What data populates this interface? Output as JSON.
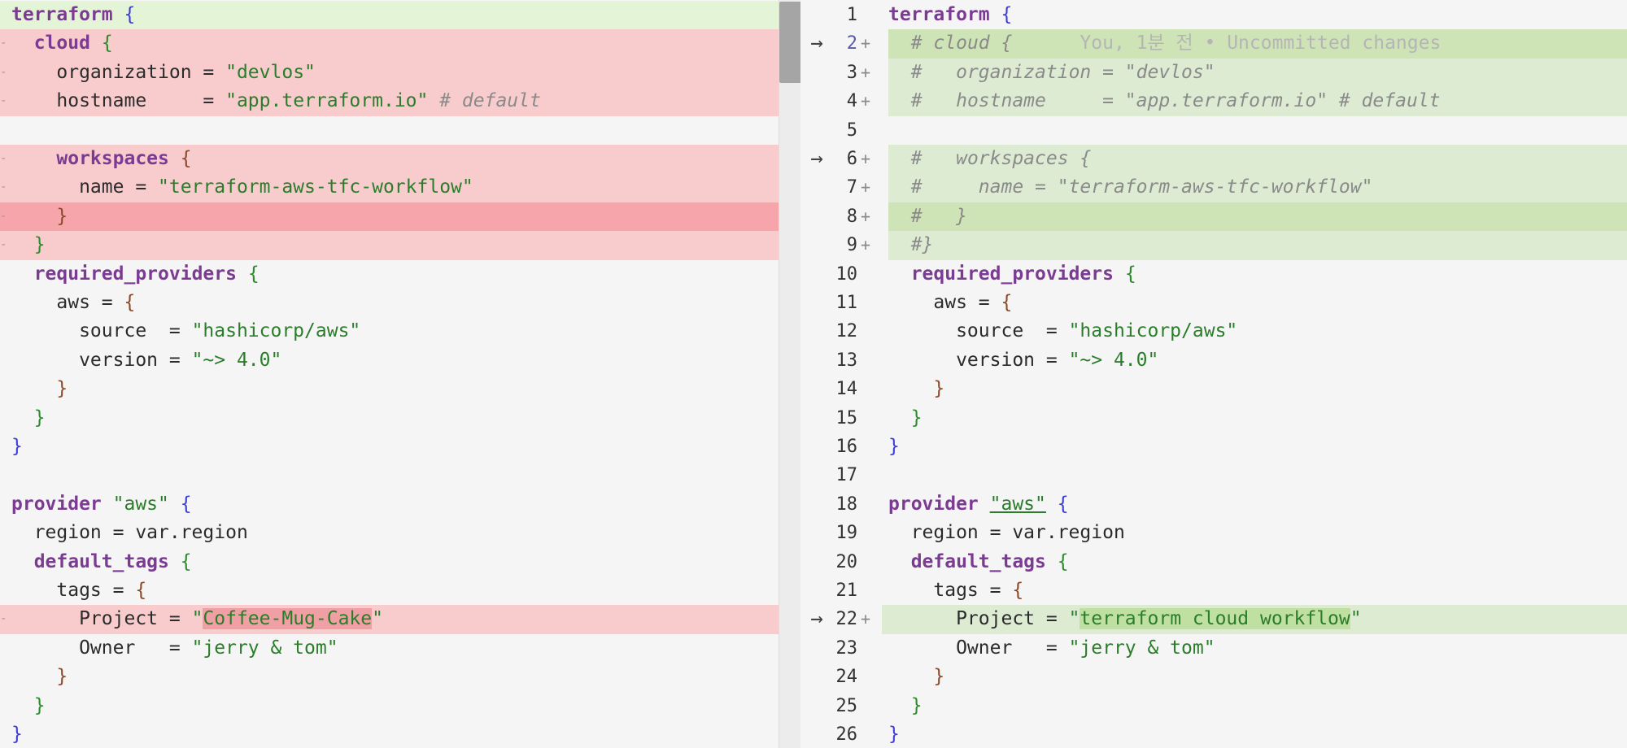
{
  "left": {
    "lines": [
      {
        "cls": "ctx-green",
        "tokens": [
          {
            "t": "terraform",
            "c": "kw"
          },
          {
            "t": " "
          },
          {
            "t": "{",
            "c": "brace"
          }
        ]
      },
      {
        "cls": "rm",
        "mark": "-",
        "tokens": [
          {
            "t": "  "
          },
          {
            "t": "cloud",
            "c": "kw"
          },
          {
            "t": " "
          },
          {
            "t": "{",
            "c": "brace2"
          }
        ]
      },
      {
        "cls": "rm",
        "mark": "-",
        "tokens": [
          {
            "t": "    organization = "
          },
          {
            "t": "\"devlos\"",
            "c": "str"
          }
        ]
      },
      {
        "cls": "rm",
        "mark": "-",
        "tokens": [
          {
            "t": "    hostname     = "
          },
          {
            "t": "\"app.terraform.io\"",
            "c": "str"
          },
          {
            "t": " "
          },
          {
            "t": "# default",
            "c": "cm"
          }
        ]
      },
      {
        "cls": "",
        "tokens": [
          {
            "t": ""
          }
        ]
      },
      {
        "cls": "rm",
        "mark": "-",
        "tokens": [
          {
            "t": "    "
          },
          {
            "t": "workspaces",
            "c": "kw"
          },
          {
            "t": " "
          },
          {
            "t": "{",
            "c": "brace3"
          }
        ]
      },
      {
        "cls": "rm",
        "mark": "-",
        "tokens": [
          {
            "t": "      name = "
          },
          {
            "t": "\"terraform-aws-tfc-workflow\"",
            "c": "str"
          }
        ]
      },
      {
        "cls": "rm-strong",
        "mark": "-",
        "tokens": [
          {
            "t": "    "
          },
          {
            "t": "}",
            "c": "brace3"
          }
        ]
      },
      {
        "cls": "rm",
        "mark": "-",
        "tokens": [
          {
            "t": "  "
          },
          {
            "t": "}",
            "c": "brace2"
          }
        ]
      },
      {
        "cls": "",
        "tokens": [
          {
            "t": "  "
          },
          {
            "t": "required_providers",
            "c": "kw"
          },
          {
            "t": " "
          },
          {
            "t": "{",
            "c": "brace2"
          }
        ]
      },
      {
        "cls": "",
        "tokens": [
          {
            "t": "    aws = "
          },
          {
            "t": "{",
            "c": "brace3"
          }
        ]
      },
      {
        "cls": "",
        "tokens": [
          {
            "t": "      source  = "
          },
          {
            "t": "\"hashicorp/aws\"",
            "c": "str"
          }
        ]
      },
      {
        "cls": "",
        "tokens": [
          {
            "t": "      version = "
          },
          {
            "t": "\"~> 4.0\"",
            "c": "str"
          }
        ]
      },
      {
        "cls": "",
        "tokens": [
          {
            "t": "    "
          },
          {
            "t": "}",
            "c": "brace3"
          }
        ]
      },
      {
        "cls": "",
        "tokens": [
          {
            "t": "  "
          },
          {
            "t": "}",
            "c": "brace2"
          }
        ]
      },
      {
        "cls": "",
        "tokens": [
          {
            "t": "}",
            "c": "brace"
          }
        ]
      },
      {
        "cls": "",
        "tokens": [
          {
            "t": ""
          }
        ]
      },
      {
        "cls": "",
        "tokens": [
          {
            "t": "provider",
            "c": "kw"
          },
          {
            "t": " "
          },
          {
            "t": "\"aws\"",
            "c": "str"
          },
          {
            "t": " "
          },
          {
            "t": "{",
            "c": "brace"
          }
        ]
      },
      {
        "cls": "",
        "tokens": [
          {
            "t": "  region = var.region"
          }
        ]
      },
      {
        "cls": "",
        "tokens": [
          {
            "t": "  "
          },
          {
            "t": "default_tags",
            "c": "kw"
          },
          {
            "t": " "
          },
          {
            "t": "{",
            "c": "brace2"
          }
        ]
      },
      {
        "cls": "",
        "tokens": [
          {
            "t": "    tags = "
          },
          {
            "t": "{",
            "c": "brace3"
          }
        ]
      },
      {
        "cls": "rm",
        "mark": "-",
        "tokens": [
          {
            "t": "      Project = "
          },
          {
            "t": "\"",
            "c": "str"
          },
          {
            "t": "Coffee-Mug-Cake",
            "c": "str hl-rm"
          },
          {
            "t": "\"",
            "c": "str"
          }
        ]
      },
      {
        "cls": "",
        "tokens": [
          {
            "t": "      Owner   = "
          },
          {
            "t": "\"jerry & tom\"",
            "c": "str"
          }
        ]
      },
      {
        "cls": "",
        "tokens": [
          {
            "t": "    "
          },
          {
            "t": "}",
            "c": "brace3"
          }
        ]
      },
      {
        "cls": "",
        "tokens": [
          {
            "t": "  "
          },
          {
            "t": "}",
            "c": "brace2"
          }
        ]
      },
      {
        "cls": "",
        "tokens": [
          {
            "t": "}",
            "c": "brace"
          }
        ]
      }
    ]
  },
  "right": {
    "lines": [
      {
        "num": "1",
        "cls": "",
        "tokens": [
          {
            "t": "terraform",
            "c": "kw"
          },
          {
            "t": " "
          },
          {
            "t": "{",
            "c": "brace"
          }
        ]
      },
      {
        "num": "2",
        "changed": true,
        "plus": true,
        "arrow": true,
        "cls": "add-strong",
        "tokens": [
          {
            "t": "  "
          },
          {
            "t": "# cloud {",
            "c": "cm"
          },
          {
            "t": "      You, 1분 전 • Uncommitted changes",
            "c": "blame"
          }
        ]
      },
      {
        "num": "3",
        "plus": true,
        "cls": "add",
        "tokens": [
          {
            "t": "  "
          },
          {
            "t": "#   organization = \"devlos\"",
            "c": "cm"
          }
        ]
      },
      {
        "num": "4",
        "plus": true,
        "cls": "add",
        "tokens": [
          {
            "t": "  "
          },
          {
            "t": "#   hostname     = \"app.terraform.io\" # default",
            "c": "cm"
          }
        ]
      },
      {
        "num": "5",
        "cls": "",
        "tokens": [
          {
            "t": ""
          }
        ]
      },
      {
        "num": "6",
        "plus": true,
        "arrow": true,
        "cls": "add",
        "tokens": [
          {
            "t": "  "
          },
          {
            "t": "#   workspaces {",
            "c": "cm"
          }
        ]
      },
      {
        "num": "7",
        "plus": true,
        "cls": "add",
        "tokens": [
          {
            "t": "  "
          },
          {
            "t": "#     name = \"terraform-aws-tfc-workflow\"",
            "c": "cm"
          }
        ]
      },
      {
        "num": "8",
        "plus": true,
        "cls": "add-strong",
        "tokens": [
          {
            "t": "  "
          },
          {
            "t": "#   }",
            "c": "cm"
          }
        ]
      },
      {
        "num": "9",
        "plus": true,
        "cls": "add",
        "tokens": [
          {
            "t": "  "
          },
          {
            "t": "#}",
            "c": "cm"
          }
        ]
      },
      {
        "num": "10",
        "cls": "",
        "tokens": [
          {
            "t": "  "
          },
          {
            "t": "required_providers",
            "c": "kw"
          },
          {
            "t": " "
          },
          {
            "t": "{",
            "c": "brace2"
          }
        ]
      },
      {
        "num": "11",
        "cls": "",
        "tokens": [
          {
            "t": "    aws = "
          },
          {
            "t": "{",
            "c": "brace3"
          }
        ]
      },
      {
        "num": "12",
        "cls": "",
        "tokens": [
          {
            "t": "      source  = "
          },
          {
            "t": "\"hashicorp/aws\"",
            "c": "str"
          }
        ]
      },
      {
        "num": "13",
        "cls": "",
        "tokens": [
          {
            "t": "      version = "
          },
          {
            "t": "\"~> 4.0\"",
            "c": "str"
          }
        ]
      },
      {
        "num": "14",
        "cls": "",
        "tokens": [
          {
            "t": "    "
          },
          {
            "t": "}",
            "c": "brace3"
          }
        ]
      },
      {
        "num": "15",
        "cls": "",
        "tokens": [
          {
            "t": "  "
          },
          {
            "t": "}",
            "c": "brace2"
          }
        ]
      },
      {
        "num": "16",
        "cls": "",
        "tokens": [
          {
            "t": "}",
            "c": "brace"
          }
        ]
      },
      {
        "num": "17",
        "cls": "",
        "tokens": [
          {
            "t": ""
          }
        ]
      },
      {
        "num": "18",
        "cls": "",
        "tokens": [
          {
            "t": "provider",
            "c": "kw"
          },
          {
            "t": " "
          },
          {
            "t": "\"aws\"",
            "c": "str ul"
          },
          {
            "t": " "
          },
          {
            "t": "{",
            "c": "brace"
          }
        ]
      },
      {
        "num": "19",
        "cls": "",
        "tokens": [
          {
            "t": "  region = var.region"
          }
        ]
      },
      {
        "num": "20",
        "cls": "",
        "tokens": [
          {
            "t": "  "
          },
          {
            "t": "default_tags",
            "c": "kw"
          },
          {
            "t": " "
          },
          {
            "t": "{",
            "c": "brace2"
          }
        ]
      },
      {
        "num": "21",
        "cls": "",
        "tokens": [
          {
            "t": "    tags = "
          },
          {
            "t": "{",
            "c": "brace3"
          }
        ]
      },
      {
        "num": "22",
        "plus": true,
        "arrow": true,
        "cls": "add",
        "tokens": [
          {
            "t": "      Project = "
          },
          {
            "t": "\"",
            "c": "str"
          },
          {
            "t": "terraform cloud workflow",
            "c": "str hl-add"
          },
          {
            "t": "\"",
            "c": "str"
          }
        ]
      },
      {
        "num": "23",
        "cls": "",
        "tokens": [
          {
            "t": "      Owner   = "
          },
          {
            "t": "\"jerry & tom\"",
            "c": "str"
          }
        ]
      },
      {
        "num": "24",
        "cls": "",
        "tokens": [
          {
            "t": "    "
          },
          {
            "t": "}",
            "c": "brace3"
          }
        ]
      },
      {
        "num": "25",
        "cls": "",
        "tokens": [
          {
            "t": "  "
          },
          {
            "t": "}",
            "c": "brace2"
          }
        ]
      },
      {
        "num": "26",
        "cls": "",
        "tokens": [
          {
            "t": "}",
            "c": "brace"
          }
        ]
      }
    ]
  },
  "icons": {
    "revert_arrow": "→",
    "added_marker": "+",
    "removed_marker": "-"
  }
}
